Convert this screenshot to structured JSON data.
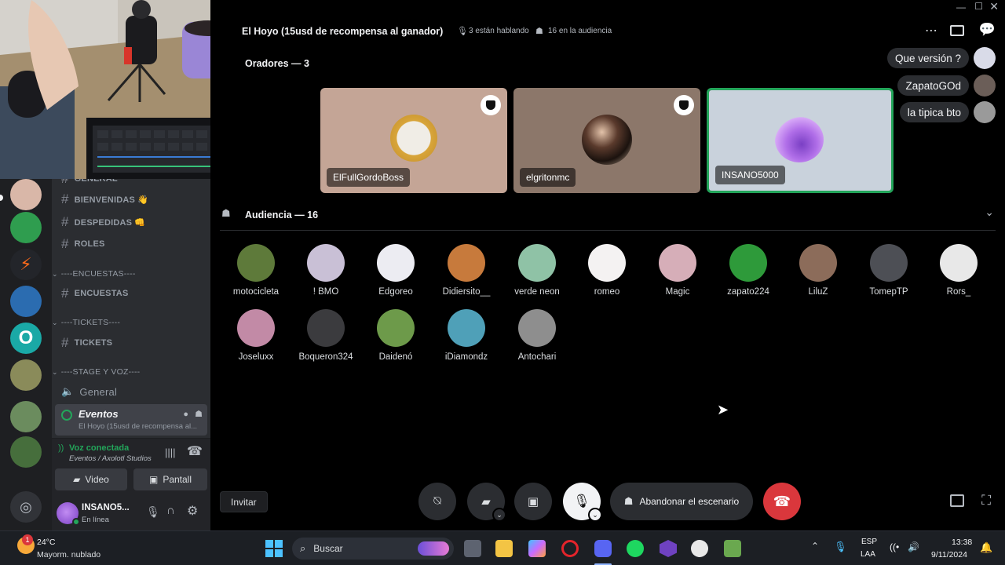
{
  "stage": {
    "title": "El Hoyo (15usd de recompensa al ganador)",
    "speaking_info": "3 están hablando",
    "audience_info": "16 en la audiencia",
    "speakers_heading": "Oradores — 3",
    "audience_heading": "Audiencia — 16"
  },
  "speakers": [
    {
      "name": "ElFullGordoBoss",
      "bg": "#c4a596",
      "moderator": true
    },
    {
      "name": "elgritonmc",
      "bg": "#8c776a",
      "moderator": true
    },
    {
      "name": "INSANO5000",
      "bg": "#c9d2dc",
      "moderator": false,
      "speaking": true
    }
  ],
  "audience": [
    {
      "name": "motocicleta",
      "color": "#5e7a3a"
    },
    {
      "name": "! BMO",
      "color": "#c9c0d6"
    },
    {
      "name": "Edgoreo",
      "color": "#ececf2"
    },
    {
      "name": "Didiersito__",
      "color": "#c77a3c"
    },
    {
      "name": "verde neon",
      "color": "#8fc2a6"
    },
    {
      "name": "romeo",
      "color": "#f4f2f2"
    },
    {
      "name": "Magic",
      "color": "#d6aeb8"
    },
    {
      "name": "zapato224",
      "color": "#2e9a3a"
    },
    {
      "name": "LiluZ",
      "color": "#8c6c5a"
    },
    {
      "name": "TomepTP",
      "color": "#4d4f55"
    },
    {
      "name": "Rors_",
      "color": "#e8e8e8"
    },
    {
      "name": "Joseluxx",
      "color": "#c28aa6"
    },
    {
      "name": "Boqueron324",
      "color": "#3b3b3e"
    },
    {
      "name": "Daidenó",
      "color": "#6d9a4a"
    },
    {
      "name": "iDiamondz",
      "color": "#4fa0b8"
    },
    {
      "name": "Antochari",
      "color": "#8e8e8e"
    }
  ],
  "chat": [
    {
      "text": "Que versión ?",
      "color": "#d9dbe8"
    },
    {
      "text": "ZapatoGOd",
      "color": "#6b5e58"
    },
    {
      "text": "la tipica bto",
      "color": "#9a9a9a"
    }
  ],
  "controls": {
    "leave_stage": "Abandonar el escenario",
    "invite": "Invitar"
  },
  "sidebar": {
    "channels": [
      {
        "label": "GENERAL",
        "icon": "hash-icon"
      },
      {
        "label": "BIENVENIDAS 👋",
        "icon": "hash-icon"
      },
      {
        "label": "DESPEDIDAS 👊",
        "icon": "hash-icon"
      },
      {
        "label": "ROLES",
        "icon": "hash-icon"
      }
    ],
    "categories": {
      "encuestas": "----ENCUESTAS----",
      "tickets": "----TICKETS----",
      "stage": "----STAGE Y VOZ----"
    },
    "encuestas_channel": "ENCUESTAS",
    "tickets_channel": "TICKETS",
    "general_voice": "General",
    "events_channel": "Eventos",
    "events_subtitle": "El Hoyo (15usd de recompensa al...",
    "voice_status": "Voz conectada",
    "voice_location": "Eventos / Axolotl Studios",
    "video_button": "Video",
    "screen_button": "Pantall",
    "username": "INSANO5...",
    "user_status": "En línea"
  },
  "taskbar": {
    "temperature": "24°C",
    "weather": "Mayorm. nublado",
    "search_placeholder": "Buscar",
    "lang_top": "ESP",
    "lang_bottom": "LAA",
    "time": "13:38",
    "date": "9/11/2024",
    "weather_badge": "1"
  },
  "colors": {
    "accent_green": "#23a55a",
    "danger_red": "#da373c",
    "blurple": "#5865f2"
  }
}
